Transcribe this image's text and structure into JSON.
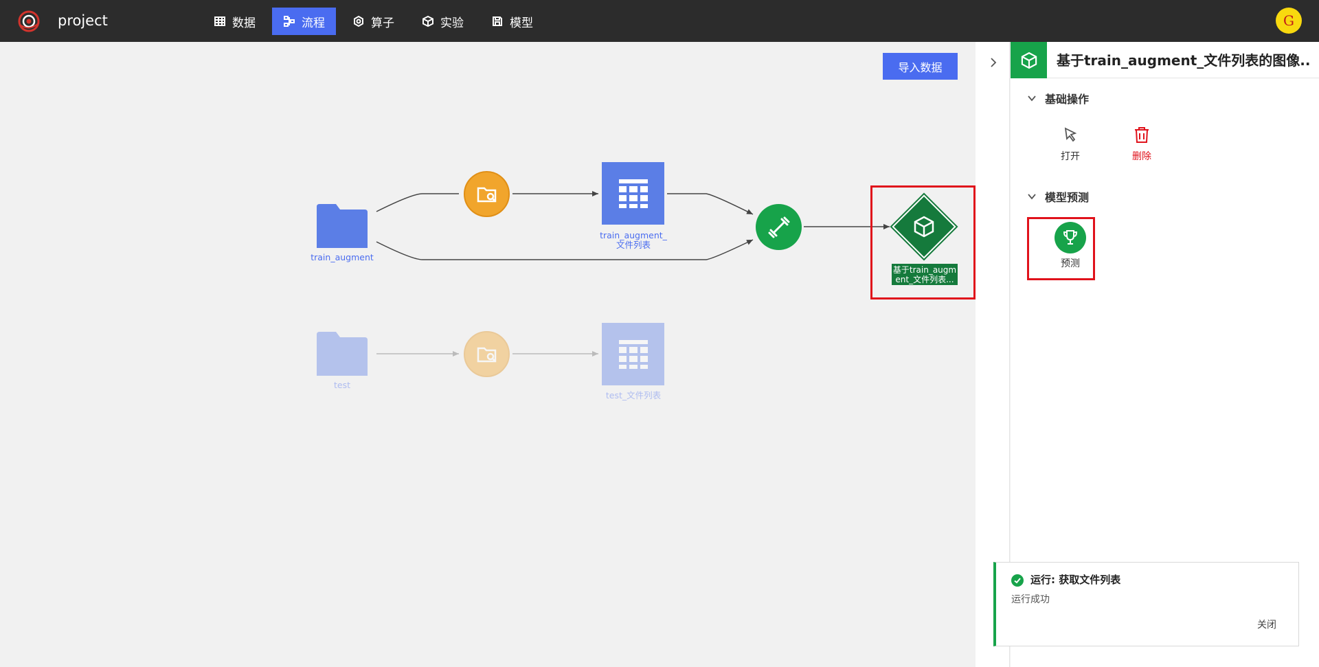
{
  "app": {
    "project_name": "project",
    "user_initial": "G"
  },
  "nav": {
    "items": [
      {
        "label": "数据",
        "icon": "table-icon"
      },
      {
        "label": "流程",
        "icon": "workflow-icon",
        "active": true
      },
      {
        "label": "算子",
        "icon": "hexagon-icon"
      },
      {
        "label": "实验",
        "icon": "cube-icon"
      },
      {
        "label": "模型",
        "icon": "save-icon"
      }
    ]
  },
  "canvas": {
    "import_button": "导入数据",
    "nodes": {
      "train_folder": "train_augment",
      "train_table": "train_augment_\n文件列表",
      "model": "基于train_augm\nent_文件列表...",
      "test_folder": "test",
      "test_table": "test_文件列表"
    }
  },
  "panel": {
    "title": "基于train_augment_文件列表的图像...",
    "section_basic": "基础操作",
    "action_open": "打开",
    "action_delete": "删除",
    "section_predict": "模型预测",
    "action_predict": "预测"
  },
  "toast": {
    "title": "运行: 获取文件列表",
    "message": "运行成功",
    "close": "关闭"
  },
  "colors": {
    "accent": "#4a6cf0",
    "success": "#17a34a",
    "model": "#157a3c",
    "orange": "#f1a52c",
    "danger": "#e0121b"
  }
}
